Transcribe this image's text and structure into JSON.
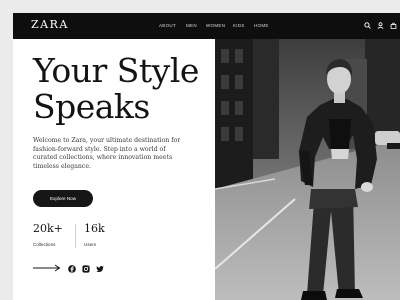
{
  "header": {
    "logo": "ZARA",
    "nav": [
      "ABOUT",
      "MEN",
      "WOMEN",
      "KIDS",
      "HOME"
    ],
    "icons": [
      "search-icon",
      "user-icon",
      "bag-icon"
    ]
  },
  "hero": {
    "headline": "Your Style\nSpeaks",
    "tagline": "Welcome to Zara, your ultimate destination for fashion-forward style. Step into a world of curated collections, where innovation meets timeless elegance.",
    "cta_label": "Explore Now",
    "stats": [
      {
        "value": "20k+",
        "label": "Collections"
      },
      {
        "value": "16k",
        "label": "Users"
      }
    ],
    "social_icons": [
      "facebook-icon",
      "instagram-icon",
      "twitter-icon"
    ]
  },
  "colors": {
    "topbar": "#0e0e0e",
    "button": "#161616",
    "text": "#141414",
    "background": "#ffffff"
  }
}
